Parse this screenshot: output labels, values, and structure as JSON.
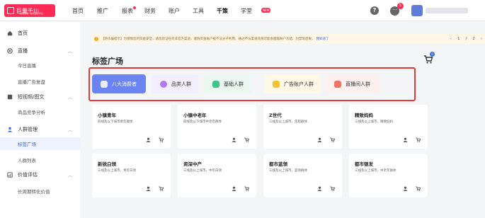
{
  "header": {
    "logo_text": "巨量千川",
    "logo_sub": "电商营销一站式服务平台",
    "nav": [
      {
        "label": "首页"
      },
      {
        "label": "推广"
      },
      {
        "label": "报表"
      },
      {
        "label": "财务"
      },
      {
        "label": "账户"
      },
      {
        "label": "工具"
      },
      {
        "label": "千策"
      },
      {
        "label": "学堂"
      }
    ],
    "new_tag": "NEW",
    "help_icon": "question-icon",
    "message_count": "5"
  },
  "sidebar": {
    "items": [
      {
        "label": "首页",
        "icon": "home-icon"
      },
      {
        "label": "直播",
        "icon": "live-icon"
      },
      {
        "label": "短视频/图文",
        "icon": "video-icon"
      },
      {
        "label": "人群管理",
        "icon": "user-icon"
      },
      {
        "label": "价值评估",
        "icon": "chart-icon"
      }
    ],
    "sub": {
      "live_today": "今日直播",
      "live_review": "直播广告复盘",
      "product_analysis": "商品竞争分析",
      "tag_square": "标签广场",
      "crowd_list": "人群列表",
      "long_cycle": "长周期转化价值"
    }
  },
  "notice": {
    "text": "【防诈骗提示】为保障您的资金安全，请您验证任何非官方渠道，谨防资金账户被不法分子利用。通过不法渠道充值可能会面临账户冻结、封禁等后果。",
    "link": "我知道了",
    "page": "1",
    "sep": "/",
    "total": "2"
  },
  "page": {
    "title": "标签广场",
    "cart_count": "0"
  },
  "categories": [
    {
      "label": "八大消费者"
    },
    {
      "label": "品类人群"
    },
    {
      "label": "基础人群"
    },
    {
      "label": "广告账户人群"
    },
    {
      "label": "直播间人群"
    }
  ],
  "cards": [
    {
      "title": "小镇青年",
      "desc": "四线及以下城市青年群体"
    },
    {
      "title": "小镇中老年",
      "desc": "四线及以下城市中老年群体"
    },
    {
      "title": "Z世代",
      "desc": "三线及以上城市，年轻群体"
    },
    {
      "title": "精致妈妈",
      "desc": "三线及以上城市，精致妈妈"
    },
    {
      "title": "新锐白领",
      "desc": "三线及以上城市，青年白领"
    },
    {
      "title": "资深中产",
      "desc": "三线及以上城市，中年白领"
    },
    {
      "title": "都市蓝领",
      "desc": "三线及以上城市，蓝领群体"
    },
    {
      "title": "都市银发",
      "desc": "三线及以上城市，中老年群体"
    }
  ],
  "colors": {
    "brand": "#fe2c55",
    "accent": "#3a6ae8",
    "highlight_border": "#e03b3b"
  }
}
